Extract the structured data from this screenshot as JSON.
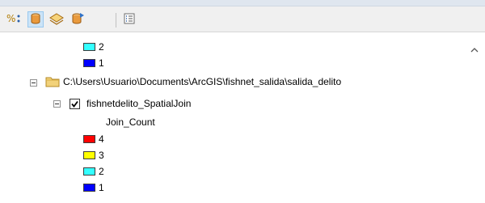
{
  "toolbar": {
    "buttons": [
      {
        "name": "list-by-drawing-order-icon"
      },
      {
        "name": "list-by-source-icon"
      },
      {
        "name": "list-by-visibility-icon"
      },
      {
        "name": "list-by-selection-icon"
      },
      {
        "name": "options-icon"
      }
    ]
  },
  "tree": {
    "upper_legend": [
      {
        "label": "2",
        "color": "#33ffff"
      },
      {
        "label": "1",
        "color": "#0000ff"
      }
    ],
    "folder_path": "C:\\Users\\Usuario\\Documents\\ArcGIS\\fishnet_salida\\salida_delito",
    "layer": {
      "name": "fishnetdelito_SpatialJoin",
      "checked": true,
      "field": "Join_Count",
      "legend": [
        {
          "label": "4",
          "color": "#ff0000"
        },
        {
          "label": "3",
          "color": "#ffff00"
        },
        {
          "label": "2",
          "color": "#33ffff"
        },
        {
          "label": "1",
          "color": "#0000ff"
        }
      ]
    }
  }
}
